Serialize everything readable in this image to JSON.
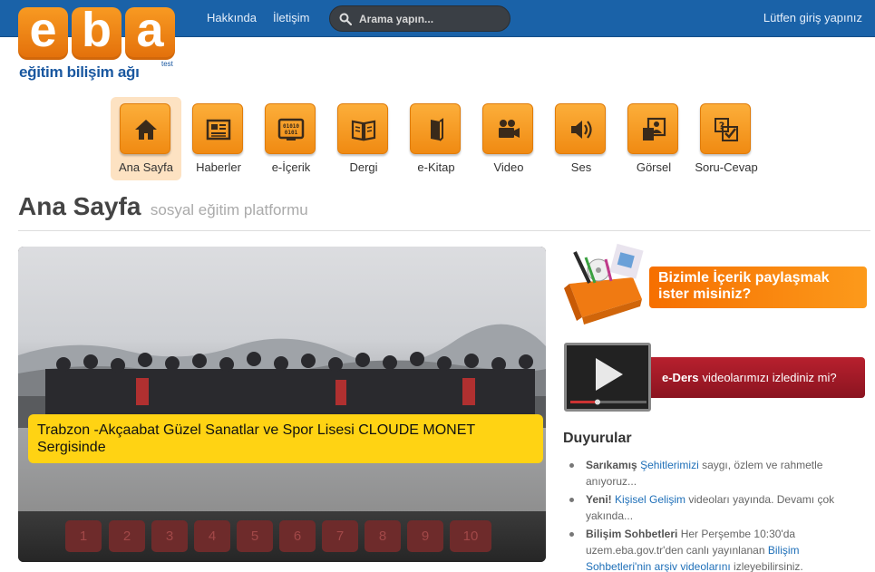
{
  "topbar": {
    "links": [
      "Hakkında",
      "İletişim"
    ],
    "search_placeholder": "Arama yapın...",
    "login": "Lütfen giriş yapınız",
    "color": "#1a62a8"
  },
  "logo": {
    "letters": [
      "e",
      "b",
      "a"
    ],
    "tagline": "eğitim bilişim ağı",
    "test": "test"
  },
  "categories": [
    {
      "label": "Ana Sayfa",
      "icon": "home-icon",
      "active": true
    },
    {
      "label": "Haberler",
      "icon": "newspaper-icon"
    },
    {
      "label": "e-İçerik",
      "icon": "binary-screen-icon"
    },
    {
      "label": "Dergi",
      "icon": "open-book-icon"
    },
    {
      "label": "e-Kitap",
      "icon": "ebook-icon"
    },
    {
      "label": "Video",
      "icon": "video-camera-icon"
    },
    {
      "label": "Ses",
      "icon": "speaker-icon"
    },
    {
      "label": "Görsel",
      "icon": "picture-icon"
    },
    {
      "label": "Soru-Cevap",
      "icon": "question-check-icon"
    }
  ],
  "heading": {
    "title": "Ana Sayfa",
    "subtitle": "sosyal eğitim platformu"
  },
  "slider": {
    "caption": "Trabzon -Akçaabat Güzel Sanatlar ve Spor Lisesi CLOUDE MONET Sergisinde",
    "pages": [
      "1",
      "2",
      "3",
      "4",
      "5",
      "6",
      "7",
      "8",
      "9",
      "10"
    ]
  },
  "promo": {
    "text": "Bizimle İçerik  paylaşmak ister misiniz?"
  },
  "eders": {
    "bold": "e-Ders",
    "text": "videolarımızı izlediniz mi?"
  },
  "announcements": {
    "title": "Duyurular",
    "items": [
      {
        "bold": "Sarıkamış",
        "link": "Şehitlerimizi",
        "rest": " saygı, özlem ve rahmetle anıyoruz..."
      },
      {
        "bold": "Yeni!",
        "link": "Kişisel Gelişim",
        "rest": " videoları yayında. Devamı çok yakında..."
      },
      {
        "bold": "Bilişim Sohbetleri",
        "pre": " Her Perşembe 10:30'da uzem.eba.gov.tr'den canlı yayınlanan ",
        "link": "Bilişim Sohbetleri'nin arşiv videolarını",
        "rest": " izleyebilirsiniz."
      }
    ]
  }
}
